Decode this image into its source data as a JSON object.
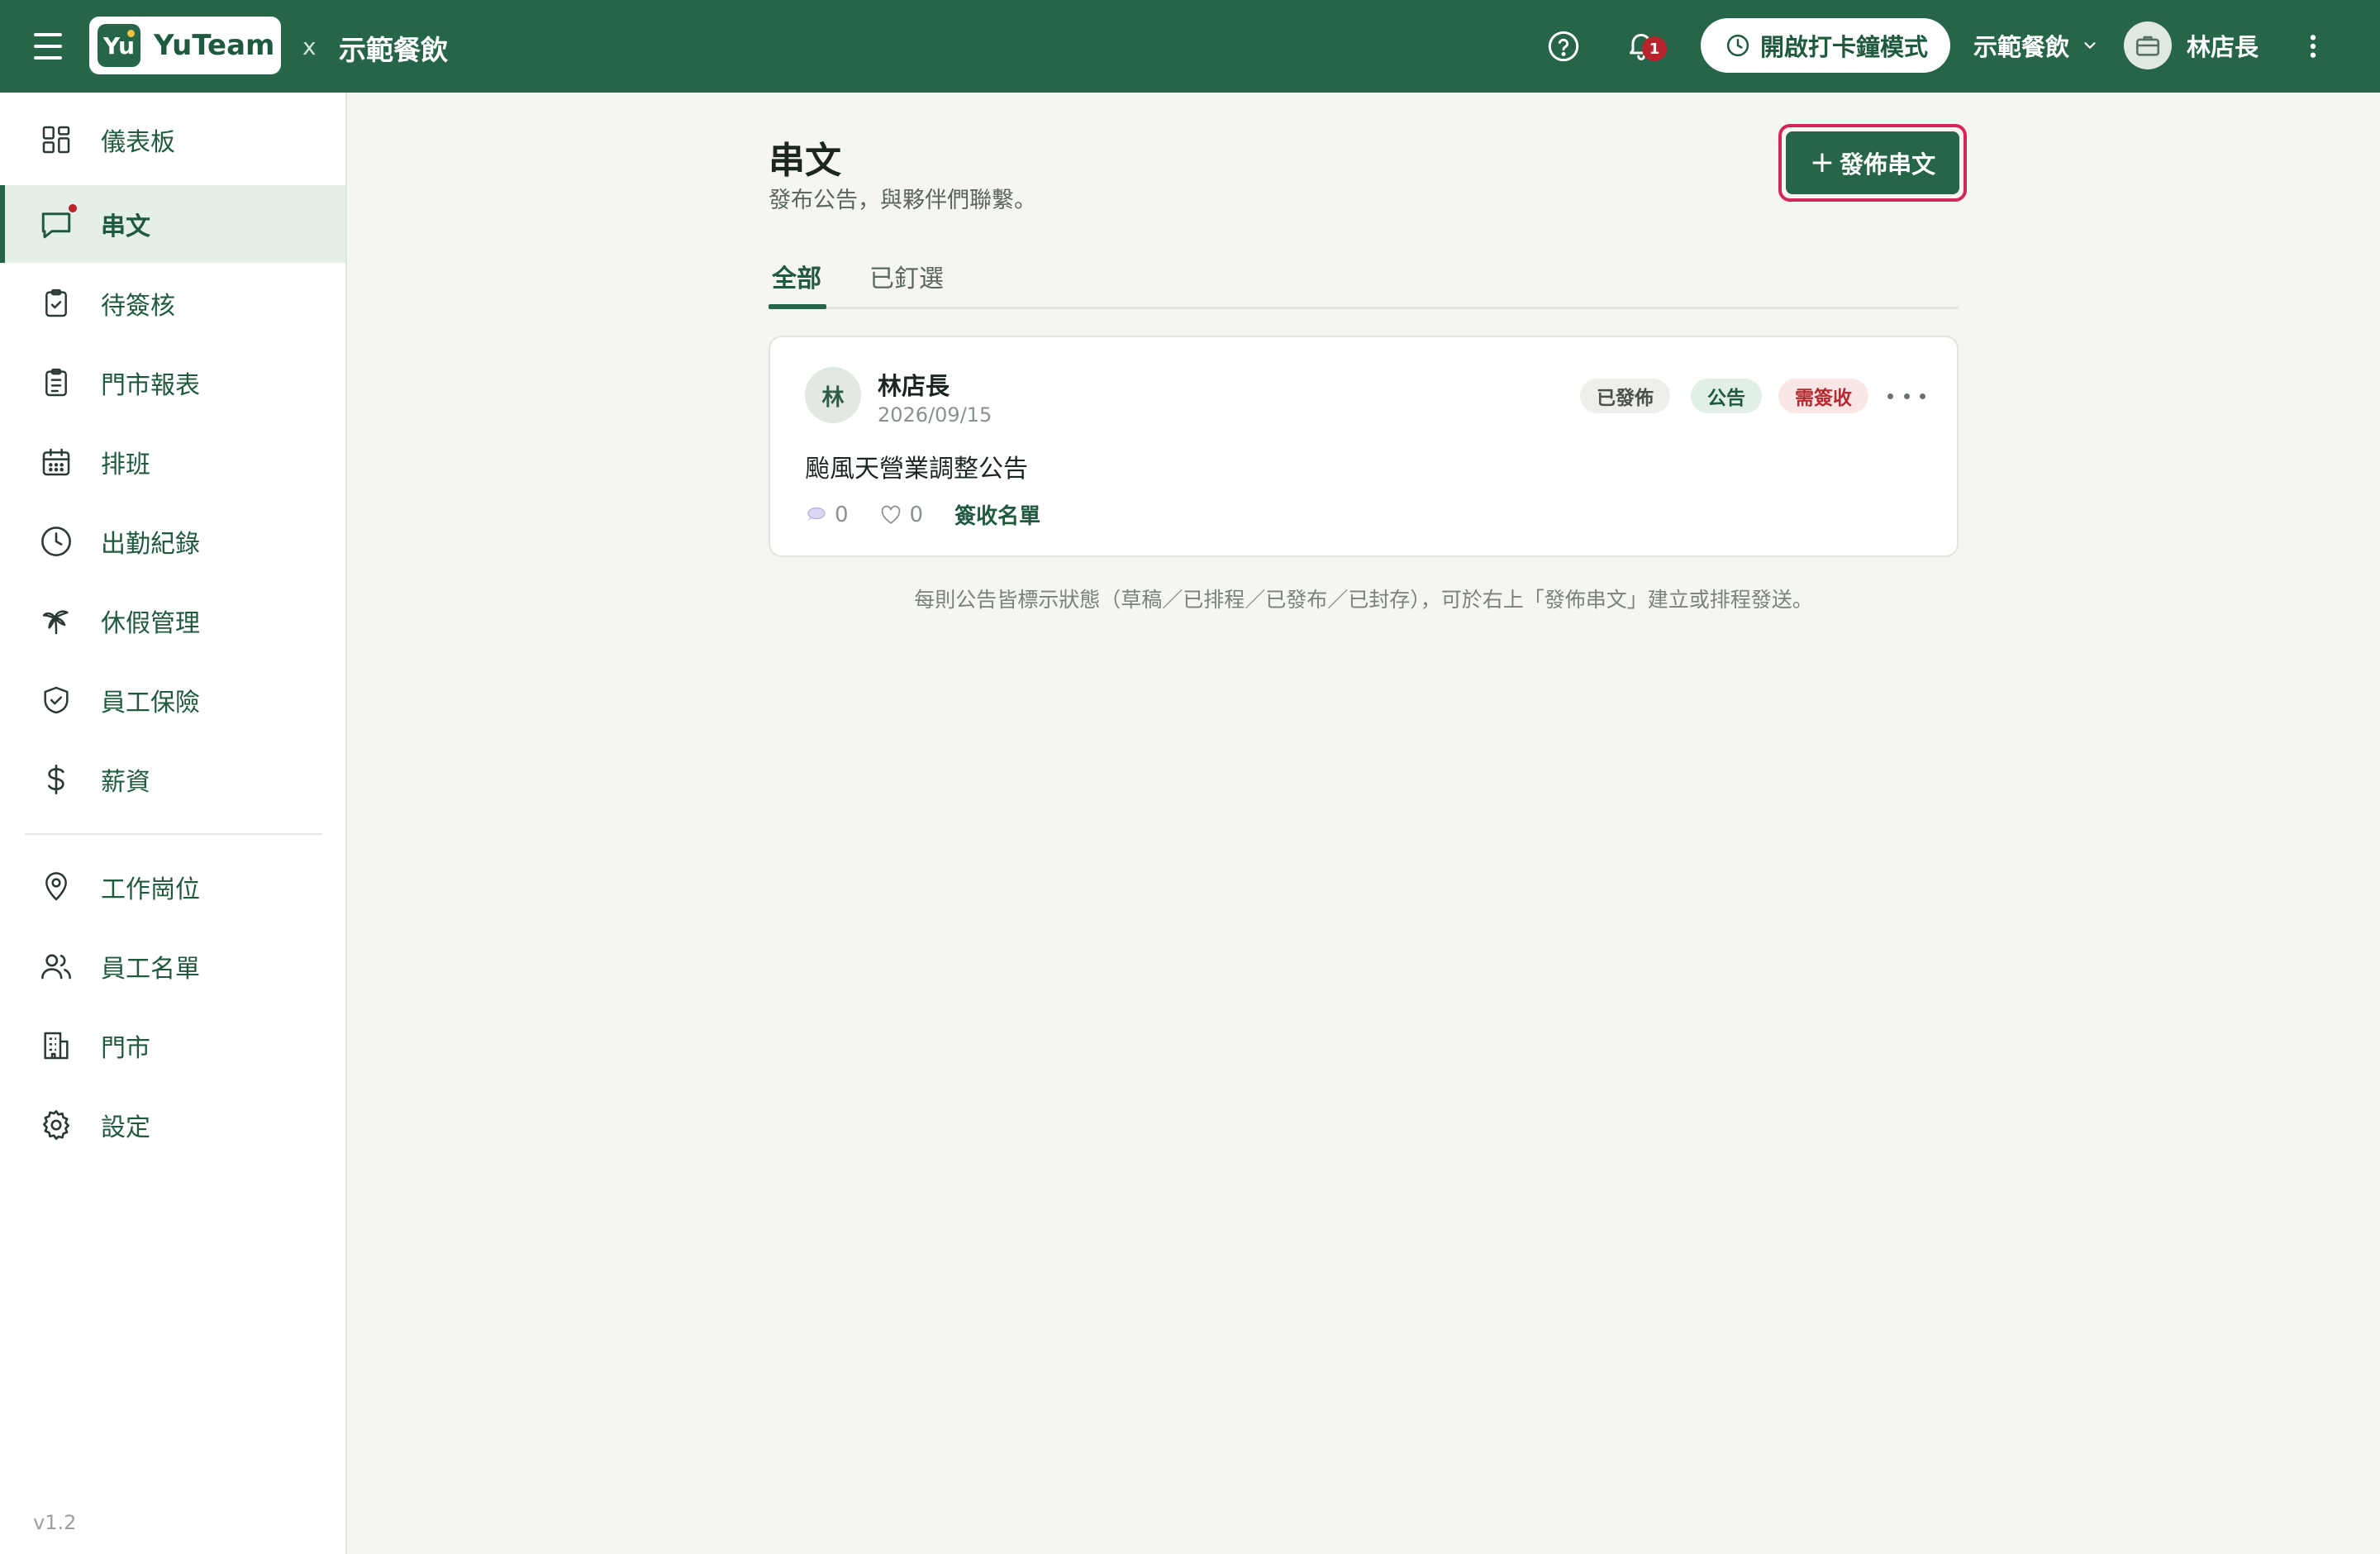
{
  "colors": {
    "brand": "#276548",
    "brand_text": "#1f5a3f",
    "alert": "#b8242c",
    "highlight_ring": "#d4265a",
    "background": "#f5f5f1"
  },
  "topbar": {
    "menu_icon": "hamburger-icon",
    "logo_mark": "Yu",
    "logo_name": "YuTeam",
    "separator": "x",
    "org_title": "示範餐飲",
    "help_icon": "question-circle-icon",
    "notification_icon": "bell-icon",
    "notification_count": "1",
    "clock_mode_label": "開啟打卡鐘模式",
    "clock_mode_icon": "clock-icon",
    "org_selector": "示範餐飲",
    "org_selector_icon": "chevron-down-icon",
    "user_avatar_icon": "briefcase-icon",
    "user_name": "林店長",
    "more_icon": "vertical-dots-icon"
  },
  "sidebar": {
    "items": [
      {
        "label": "儀表板",
        "icon": "dashboard-grid-icon",
        "active": false
      },
      {
        "label": "串文",
        "icon": "chat-bubble-icon",
        "active": true,
        "has_dot": true
      },
      {
        "label": "待簽核",
        "icon": "clipboard-check-icon",
        "active": false
      },
      {
        "label": "門市報表",
        "icon": "clipboard-list-icon",
        "active": false
      },
      {
        "label": "排班",
        "icon": "calendar-icon",
        "active": false
      },
      {
        "label": "出勤紀錄",
        "icon": "clock-icon",
        "active": false
      },
      {
        "label": "休假管理",
        "icon": "palm-tree-icon",
        "active": false
      },
      {
        "label": "員工保險",
        "icon": "shield-check-icon",
        "active": false
      },
      {
        "label": "薪資",
        "icon": "dollar-icon",
        "active": false
      }
    ],
    "secondary_items": [
      {
        "label": "工作崗位",
        "icon": "map-pin-icon"
      },
      {
        "label": "員工名單",
        "icon": "users-icon"
      },
      {
        "label": "門市",
        "icon": "building-icon"
      },
      {
        "label": "設定",
        "icon": "gear-icon"
      }
    ],
    "version": "v1.2"
  },
  "main": {
    "title": "串文",
    "subtitle": "發布公告，與夥伴們聯繫。",
    "publish_button": "發佈串文",
    "publish_button_plus": "+",
    "tabs": [
      {
        "label": "全部",
        "active": true
      },
      {
        "label": "已釘選",
        "active": false
      }
    ],
    "posts": [
      {
        "avatar_initial": "林",
        "author": "林店長",
        "date": "2026/09/15",
        "badges": {
          "status": "已發佈",
          "type": "公告",
          "sign": "需簽收"
        },
        "title": "颱風天營業調整公告",
        "comment_count": "0",
        "like_count": "0",
        "sign_list_label": "簽收名單"
      }
    ],
    "footnote": "每則公告皆標示狀態（草稿／已排程／已發布／已封存），可於右上「發佈串文」建立或排程發送。"
  }
}
